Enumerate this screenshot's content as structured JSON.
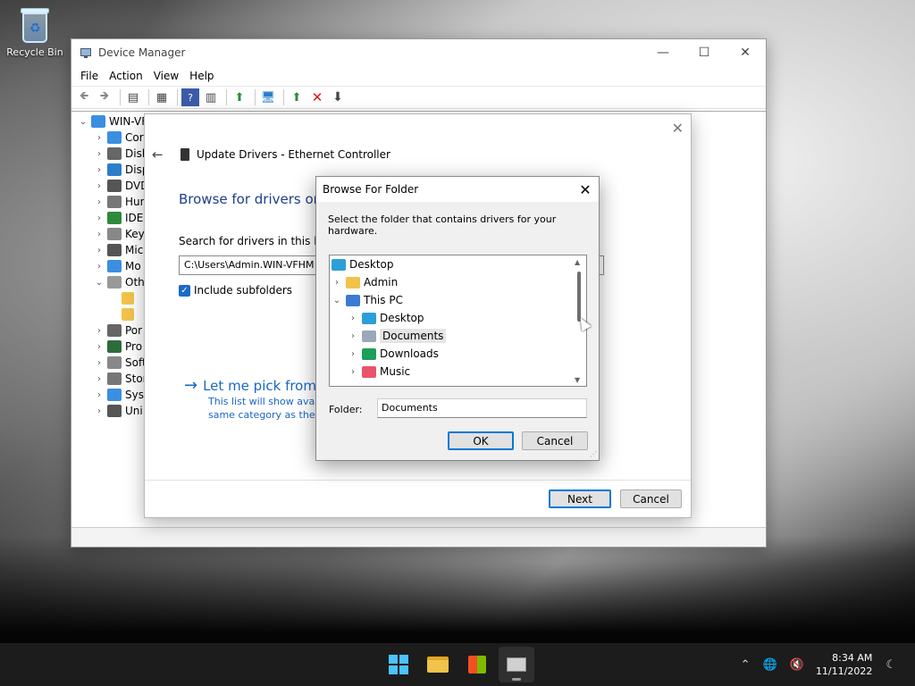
{
  "desktop": {
    "recycle_bin_label": "Recycle Bin"
  },
  "device_manager": {
    "title": "Device Manager",
    "menu": [
      "File",
      "Action",
      "View",
      "Help"
    ],
    "tree": {
      "root": "WIN-VF",
      "items": [
        {
          "label": "Cor",
          "color": "#3a8fe0"
        },
        {
          "label": "Disk",
          "color": "#666"
        },
        {
          "label": "Disp",
          "color": "#2d7dc9"
        },
        {
          "label": "DVD",
          "color": "#555"
        },
        {
          "label": "Hun",
          "color": "#777"
        },
        {
          "label": "IDE",
          "color": "#2e8b3a"
        },
        {
          "label": "Key",
          "color": "#888"
        },
        {
          "label": "Mic",
          "color": "#555"
        },
        {
          "label": "Mo",
          "color": "#3a8fe0"
        },
        {
          "label": "Oth",
          "color": "#999"
        }
      ],
      "items_after": [
        {
          "label": "Por",
          "color": "#666"
        },
        {
          "label": "Pro",
          "color": "#2e6b3a"
        },
        {
          "label": "Soft",
          "color": "#888"
        },
        {
          "label": "Stor",
          "color": "#777"
        },
        {
          "label": "Syst",
          "color": "#3a8fe0"
        },
        {
          "label": "Uni",
          "color": "#555"
        }
      ]
    }
  },
  "update_wizard": {
    "heading": "Update Drivers - Ethernet Controller",
    "title": "Browse for drivers on",
    "search_label": "Search for drivers in this locat",
    "path_value": "C:\\Users\\Admin.WIN-VFHM",
    "include_subfolders": "Include subfolders",
    "pick_link": "Let me pick from",
    "pick_desc_1": "This list will show avail",
    "pick_desc_2": "same category as the d",
    "next_label": "Next",
    "cancel_label": "Cancel"
  },
  "browse_folder": {
    "title": "Browse For Folder",
    "instruction": "Select the folder that contains drivers for your hardware.",
    "nodes": [
      {
        "label": "Desktop",
        "color": "#2ba0d8"
      },
      {
        "label": "Admin",
        "color": "#f2c34a"
      },
      {
        "label": "This PC",
        "color": "#3b7bd1"
      },
      {
        "label": "Desktop",
        "color": "#2ba0d8"
      },
      {
        "label": "Documents",
        "color": "#9aa8b8"
      },
      {
        "label": "Downloads",
        "color": "#1f9e5a"
      },
      {
        "label": "Music",
        "color": "#e8556a"
      }
    ],
    "folder_label": "Folder:",
    "folder_value": "Documents",
    "ok_label": "OK",
    "cancel_label": "Cancel"
  },
  "taskbar": {
    "time": "8:34 AM",
    "date": "11/11/2022"
  },
  "colors": {
    "accent": "#0078d4",
    "link": "#1a66c6",
    "heading": "#1e3f8a"
  }
}
